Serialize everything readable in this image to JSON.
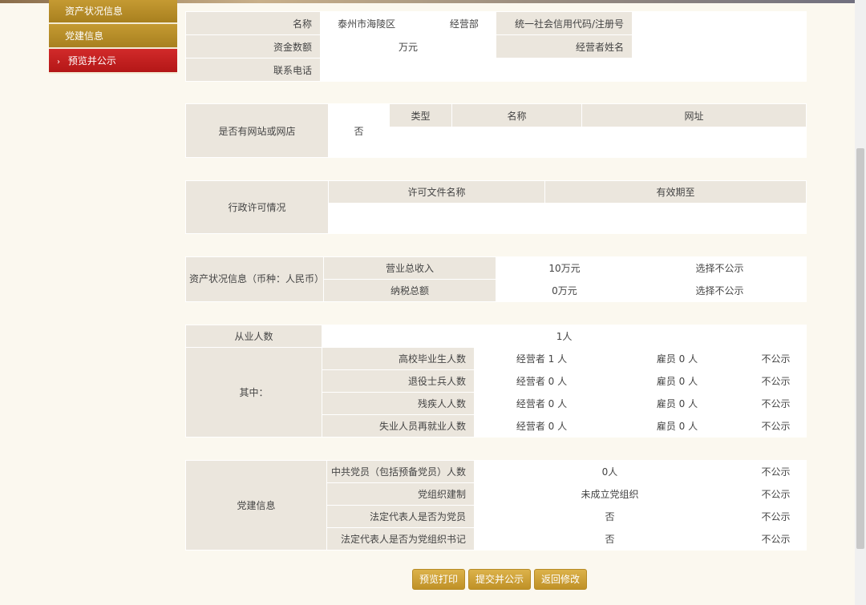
{
  "sidebar": {
    "items": [
      {
        "label": "资产状况信息"
      },
      {
        "label": "党建信息"
      },
      {
        "label": "预览并公示"
      }
    ]
  },
  "basic": {
    "name_label": "名称",
    "name_value": "泰州市海陵区",
    "name_suffix": "经营部",
    "credit_label": "统一社会信用代码/注册号",
    "capital_label": "资金数额",
    "capital_value": "万元",
    "operator_label": "经营者姓名",
    "phone_label": "联系电话"
  },
  "website": {
    "label": "是否有网站或网店",
    "value": "否",
    "headers": [
      "类型",
      "名称",
      "网址"
    ]
  },
  "license": {
    "label": "行政许可情况",
    "headers": [
      "许可文件名称",
      "有效期至"
    ]
  },
  "assets": {
    "label": "资产状况信息（币种：人民币）",
    "rows": [
      {
        "name": "营业总收入",
        "value": "10万元",
        "public": "选择不公示"
      },
      {
        "name": "纳税总额",
        "value": "0万元",
        "public": "选择不公示"
      }
    ]
  },
  "employees": {
    "label": "从业人数",
    "value": "1人",
    "sub_label": "其中：",
    "rows": [
      {
        "name": "高校毕业生人数",
        "operator": "经营者 1 人",
        "employee": "雇员 0 人",
        "public": "不公示"
      },
      {
        "name": "退役士兵人数",
        "operator": "经营者 0 人",
        "employee": "雇员 0 人",
        "public": "不公示"
      },
      {
        "name": "残疾人人数",
        "operator": "经营者 0 人",
        "employee": "雇员 0 人",
        "public": "不公示"
      },
      {
        "name": "失业人员再就业人数",
        "operator": "经营者 0 人",
        "employee": "雇员 0 人",
        "public": "不公示"
      }
    ]
  },
  "party": {
    "label": "党建信息",
    "rows": [
      {
        "name": "中共党员（包括预备党员）人数",
        "value": "0人",
        "public": "不公示"
      },
      {
        "name": "党组织建制",
        "value": "未成立党组织",
        "public": "不公示"
      },
      {
        "name": "法定代表人是否为党员",
        "value": "否",
        "public": "不公示"
      },
      {
        "name": "法定代表人是否为党组织书记",
        "value": "否",
        "public": "不公示"
      }
    ]
  },
  "buttons": {
    "preview_print": "预览打印",
    "submit_publish": "提交并公示",
    "back_edit": "返回修改"
  }
}
